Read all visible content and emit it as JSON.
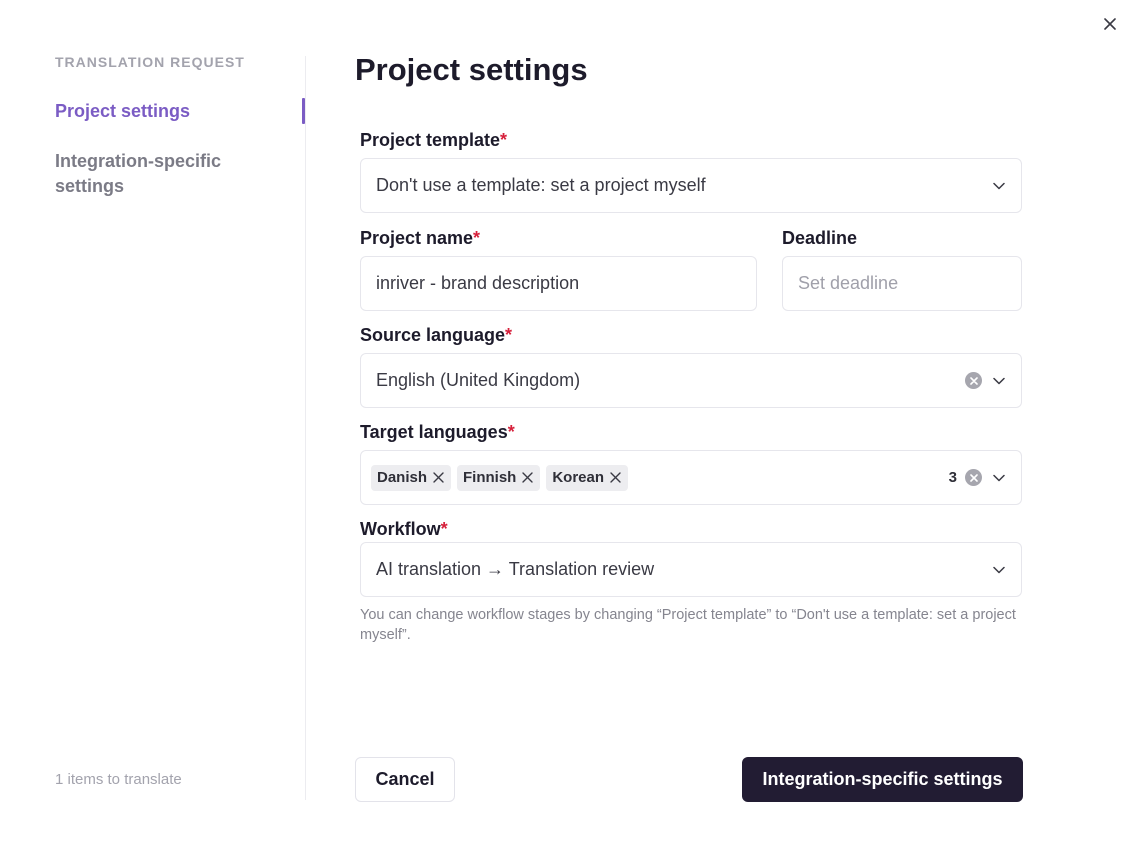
{
  "sidebar": {
    "heading": "TRANSLATION REQUEST",
    "items": [
      {
        "label": "Project settings",
        "active": true
      },
      {
        "label": "Integration-specific settings",
        "active": false
      }
    ],
    "items_count": "1 items to translate"
  },
  "main": {
    "title": "Project settings",
    "project_template": {
      "label": "Project template",
      "value": "Don't use a template: set a project myself"
    },
    "project_name": {
      "label": "Project name",
      "value": "inriver - brand description"
    },
    "deadline": {
      "label": "Deadline",
      "placeholder": "Set deadline"
    },
    "source_language": {
      "label": "Source language",
      "value": "English (United Kingdom)"
    },
    "target_languages": {
      "label": "Target languages",
      "tags": [
        "Danish",
        "Finnish",
        "Korean"
      ],
      "count": "3"
    },
    "workflow": {
      "label": "Workflow",
      "value": "AI translation → Translation review"
    },
    "hint": "You can change workflow stages by changing “Project template” to “Don't use a template: set a project myself”."
  },
  "footer": {
    "cancel_label": "Cancel",
    "next_label": "Integration-specific settings"
  },
  "required_marker": "*",
  "colors": {
    "accent": "#7b5cc4",
    "required": "#d6203b",
    "primary_button": "#221c33"
  }
}
